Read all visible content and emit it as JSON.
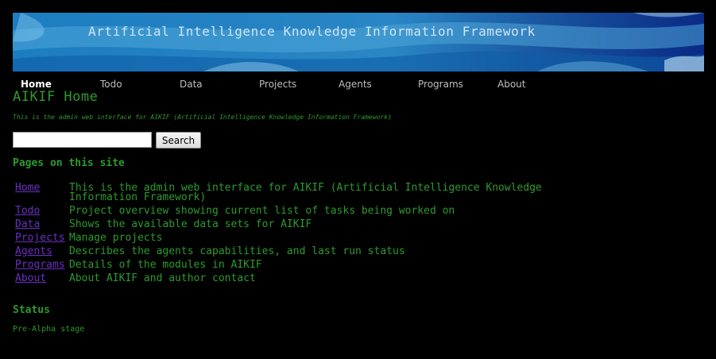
{
  "banner": {
    "title": "Artificial Intelligence Knowledge Information Framework"
  },
  "nav": {
    "items": [
      {
        "label": "Home",
        "active": true
      },
      {
        "label": "Todo"
      },
      {
        "label": "Data"
      },
      {
        "label": "Projects"
      },
      {
        "label": "Agents"
      },
      {
        "label": "Programs"
      },
      {
        "label": "About"
      }
    ]
  },
  "main": {
    "heading": "AIKIF Home",
    "tagline": "This is the admin web interface for AIKIF (Artificial Intelligence Knowledge Information Framework)"
  },
  "search": {
    "value": "",
    "placeholder": "",
    "button_label": "Search"
  },
  "pages": {
    "heading": "Pages on this site",
    "rows": [
      {
        "link": "Home",
        "desc": "This is the admin web interface for AIKIF (Artificial Intelligence Knowledge Information Framework)"
      },
      {
        "link": "Todo",
        "desc": "Project overview showing current list of tasks being worked on"
      },
      {
        "link": "Data",
        "desc": "Shows the available data sets for AIKIF"
      },
      {
        "link": "Projects",
        "desc": "Manage projects"
      },
      {
        "link": "Agents",
        "desc": "Describes the agents capabilities, and last run status"
      },
      {
        "link": "Programs",
        "desc": "Details of the modules in AIKIF"
      },
      {
        "link": "About",
        "desc": "About AIKIF and author contact"
      }
    ]
  },
  "status": {
    "heading": "Status",
    "text": "Pre-Alpha stage"
  },
  "colors": {
    "link": "#6a2fc2",
    "text_green": "#2e9b2e",
    "background": "#000000",
    "banner_blue": "#1f6fb0"
  }
}
